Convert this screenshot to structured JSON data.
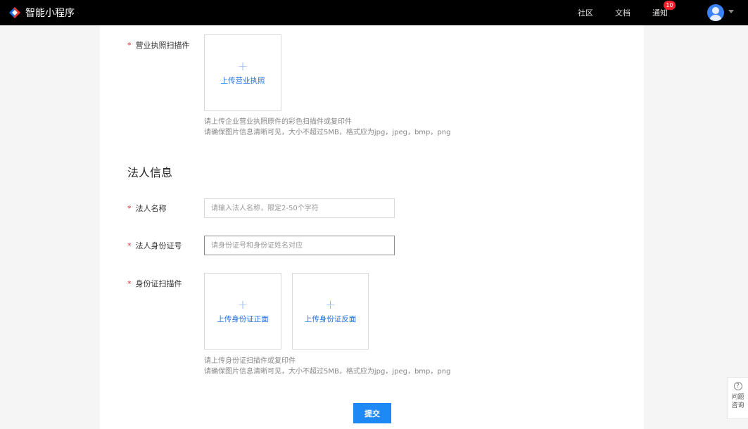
{
  "header": {
    "app_name": "智能小程序",
    "nav": {
      "community": "社区",
      "docs": "文档",
      "notice": "通知",
      "notice_badge": "10"
    },
    "colors": {
      "bar": "#000000",
      "badge": "#f5222d",
      "avatar": "#3b82f6"
    }
  },
  "form": {
    "required_mark": "*",
    "license": {
      "label": "营业执照扫描件",
      "upload_label": "上传营业执照",
      "hint_line1": "请上传企业营业执照原件的彩色扫描件或复印件",
      "hint_line2": "请确保图片信息清晰可见，大小不超过5MB，格式应为jpg，jpeg，bmp，png"
    },
    "legal_section_title": "法人信息",
    "legal_name": {
      "label": "法人名称",
      "value": "",
      "placeholder": "请输入法人名称，限定2-50个字符"
    },
    "legal_id": {
      "label": "法人身份证号",
      "value": "",
      "placeholder": "请身份证号和身份证姓名对应"
    },
    "id_scan": {
      "label": "身份证扫描件",
      "front_label": "上传身份证正面",
      "back_label": "上传身份证反面",
      "hint_line1": "请上传身份证扫描件或复印件",
      "hint_line2": "请确保图片信息清晰可见，大小不超过5MB，格式应为jpg，jpeg，bmp，png"
    },
    "submit_label": "提交",
    "accent_color": "#1e88f5"
  },
  "help_widget": {
    "icon": "question-circle-icon",
    "label": "问题咨询"
  }
}
